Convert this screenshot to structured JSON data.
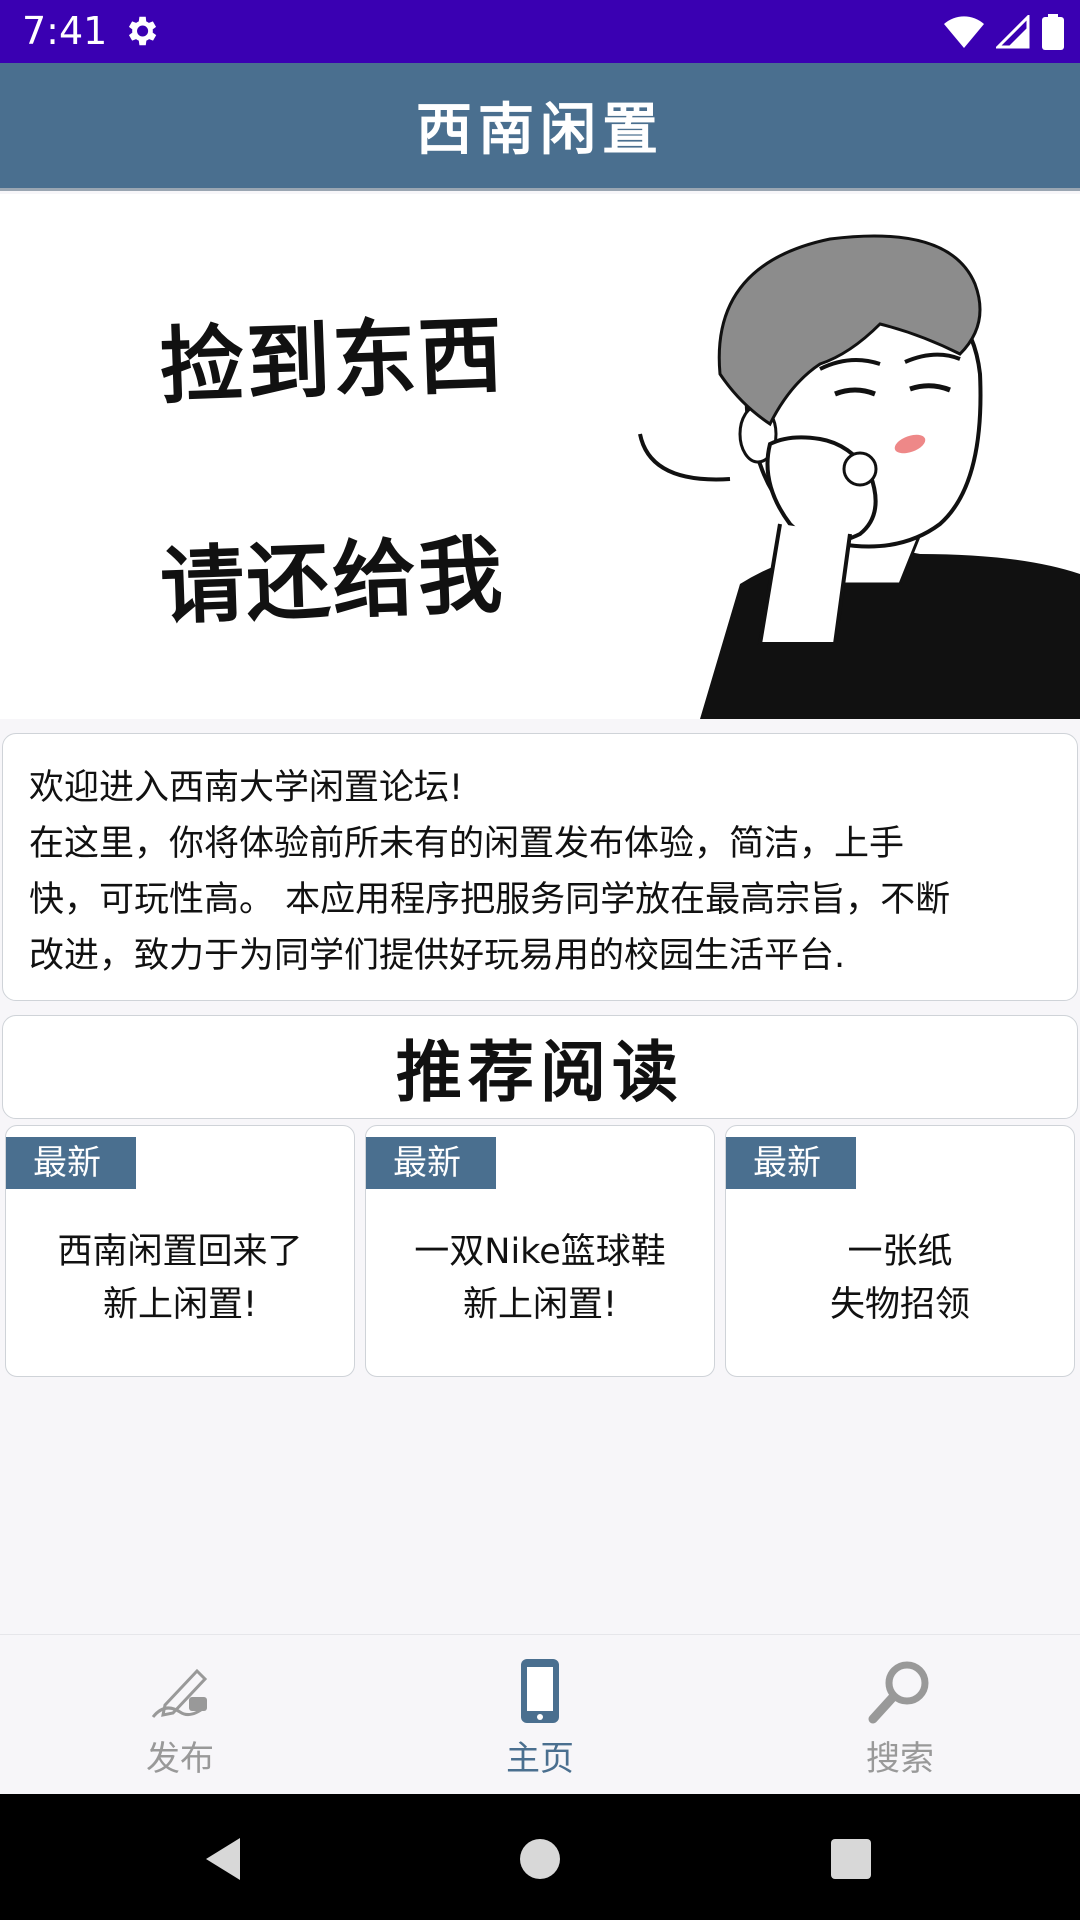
{
  "status_bar": {
    "time": "7:41",
    "icons": [
      "settings-gear-icon",
      "wifi-icon",
      "cellular-signal-icon",
      "battery-icon"
    ]
  },
  "app_bar": {
    "title": "西南闲置"
  },
  "banner": {
    "line1": "捡到东西",
    "line2": "请还给我",
    "illustration": "cartoon man pointing finger"
  },
  "intro": {
    "lines": [
      "欢迎进入西南大学闲置论坛!",
      "在这里，你将体验前所未有的闲置发布体验，简洁，上手",
      "快，可玩性高。 本应用程序把服务同学放在最高宗旨，不断",
      "改进，致力于为同学们提供好玩易用的校园生活平台."
    ]
  },
  "section": {
    "title": "推荐阅读"
  },
  "cards": [
    {
      "badge": "最新",
      "line1": "西南闲置回来了",
      "line2": "新上闲置!"
    },
    {
      "badge": "最新",
      "line1": "一双Nike篮球鞋",
      "line2": "新上闲置!"
    },
    {
      "badge": "最新",
      "line1": "一张纸",
      "line2": "失物招领"
    }
  ],
  "bottom_nav": [
    {
      "label": "发布",
      "icon": "pen-writing-icon",
      "active": false
    },
    {
      "label": "主页",
      "icon": "phone-icon",
      "active": true
    },
    {
      "label": "搜索",
      "icon": "magnifier-icon",
      "active": false
    }
  ],
  "colors": {
    "status_bar": "#3a00b2",
    "primary": "#4a6f8f",
    "inactive_nav": "#999999"
  }
}
